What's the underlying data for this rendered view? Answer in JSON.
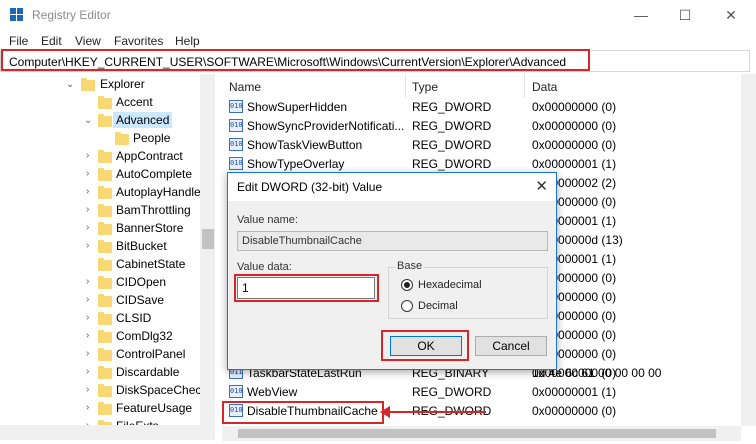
{
  "window": {
    "title": "Registry Editor",
    "controls": {
      "minimize": "—",
      "maximize": "☐",
      "close": "✕"
    }
  },
  "menu": [
    "File",
    "Edit",
    "View",
    "Favorites",
    "Help"
  ],
  "address": "Computer\\HKEY_CURRENT_USER\\SOFTWARE\\Microsoft\\Windows\\CurrentVersion\\Explorer\\Advanced",
  "tree": [
    "Explorer",
    "Accent",
    "Advanced",
    "People",
    "AppContract",
    "AutoComplete",
    "AutoplayHandle",
    "BamThrottling",
    "BannerStore",
    "BitBucket",
    "CabinetState",
    "CIDOpen",
    "CIDSave",
    "CLSID",
    "ComDlg32",
    "ControlPanel",
    "Discardable",
    "DiskSpaceCheck",
    "FeatureUsage",
    "FileExts"
  ],
  "columns": {
    "name": "Name",
    "type": "Type",
    "data": "Data"
  },
  "rows": [
    {
      "name": "ShowSuperHidden",
      "type": "REG_DWORD",
      "data": "0x00000000 (0)"
    },
    {
      "name": "ShowSyncProviderNotificati...",
      "type": "REG_DWORD",
      "data": "0x00000000 (0)"
    },
    {
      "name": "ShowTaskViewButton",
      "type": "REG_DWORD",
      "data": "0x00000000 (0)"
    },
    {
      "name": "ShowTypeOverlay",
      "type": "REG_DWORD",
      "data": "0x00000001 (1)"
    },
    {
      "name": "",
      "type": "",
      "data": "0x00000002 (2)"
    },
    {
      "name": "",
      "type": "",
      "data": "0x00000000 (0)"
    },
    {
      "name": "",
      "type": "",
      "data": "0x00000001 (1)"
    },
    {
      "name": "",
      "type": "",
      "data": "0x0000000d (13)"
    },
    {
      "name": "",
      "type": "",
      "data": "0x00000001 (1)"
    },
    {
      "name": "",
      "type": "",
      "data": "0x00000000 (0)"
    },
    {
      "name": "",
      "type": "",
      "data": "0x00000000 (0)"
    },
    {
      "name": "",
      "type": "",
      "data": "0x00000000 (0)"
    },
    {
      "name": "",
      "type": "",
      "data": "0x00000000 (0)"
    },
    {
      "name": "",
      "type": "",
      "data": "0x00000000 (0)"
    },
    {
      "name": "",
      "type": "",
      "data": "0x00000000 (0)"
    },
    {
      "name": "TaskbarStateLastRun",
      "type": "REG_BINARY",
      "data": "1d 4e 6c 61 00 00 00 00"
    },
    {
      "name": "WebView",
      "type": "REG_DWORD",
      "data": "0x00000001 (1)"
    },
    {
      "name": "DisableThumbnailCache",
      "type": "REG_DWORD",
      "data": "0x00000000 (0)"
    }
  ],
  "dialog": {
    "title": "Edit DWORD (32-bit) Value",
    "value_name_label": "Value name:",
    "value_name": "DisableThumbnailCache",
    "value_data_label": "Value data:",
    "value_data": "1",
    "base_label": "Base",
    "hex_label": "Hexadecimal",
    "dec_label": "Decimal",
    "ok": "OK",
    "cancel": "Cancel"
  },
  "colors": {
    "highlight": "#d6262a",
    "selection": "#cce8ff",
    "folder": "#f8d775"
  }
}
